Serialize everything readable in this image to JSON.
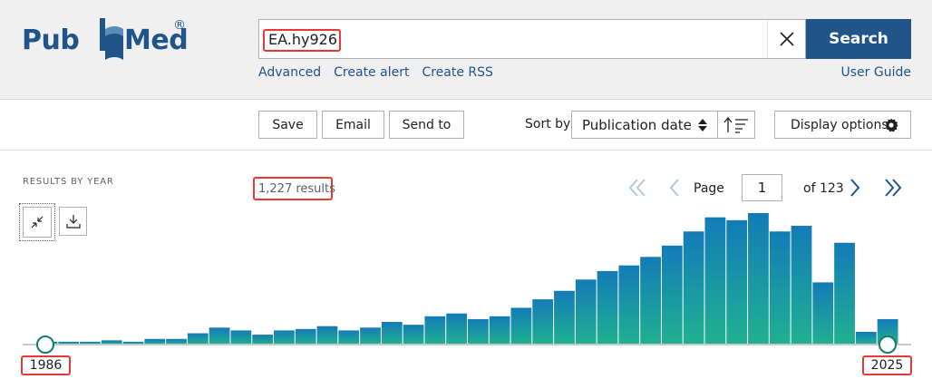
{
  "header": {
    "logo_prefix": "Pub",
    "logo_suffix": "Med",
    "logo_registered": "®",
    "search": {
      "value": "EA.hy926",
      "placeholder": ""
    },
    "search_button": "Search",
    "links": [
      "Advanced",
      "Create alert",
      "Create RSS"
    ],
    "user_guide": "User Guide"
  },
  "toolbar": {
    "save": "Save",
    "email": "Email",
    "send_to": "Send to",
    "sort_by_label": "Sort by:",
    "sort_value": "Publication date",
    "display_options": "Display options"
  },
  "results": {
    "section_label": "RESULTS BY YEAR",
    "count": "1,227 results",
    "pager": {
      "page_label": "Page",
      "page_value": "1",
      "of_label": "of 123"
    },
    "start_year": "1986",
    "end_year": "2025"
  },
  "colors": {
    "brand": "#20558a",
    "link": "#205493",
    "bar_bottom": "#20b190",
    "bar_top": "#137bb8",
    "highlight": "#e53935"
  },
  "icons": [
    "clear-icon",
    "sort-arrows-icon",
    "sort-direction-icon",
    "gear-icon",
    "first-page-icon",
    "prev-page-icon",
    "next-page-icon",
    "last-page-icon",
    "collapse-icon",
    "download-icon"
  ],
  "chart_data": {
    "type": "bar",
    "title": "",
    "x": [
      1986,
      1987,
      1988,
      1989,
      1990,
      1991,
      1992,
      1993,
      1994,
      1995,
      1996,
      1997,
      1998,
      1999,
      2000,
      2001,
      2002,
      2003,
      2004,
      2005,
      2006,
      2007,
      2008,
      2009,
      2010,
      2011,
      2012,
      2013,
      2014,
      2015,
      2016,
      2017,
      2018,
      2019,
      2020,
      2021,
      2022,
      2023,
      2024,
      2025
    ],
    "values": [
      2,
      2,
      2,
      3,
      2,
      4,
      4,
      8,
      12,
      10,
      7,
      10,
      11,
      13,
      10,
      12,
      16,
      14,
      20,
      22,
      18,
      20,
      26,
      32,
      38,
      46,
      52,
      56,
      62,
      70,
      80,
      90,
      88,
      93,
      80,
      84,
      44,
      72,
      9,
      18
    ],
    "xlabel": "",
    "ylabel": ""
  }
}
